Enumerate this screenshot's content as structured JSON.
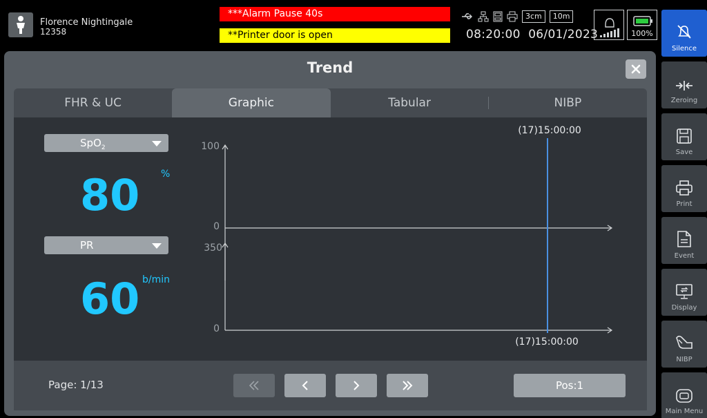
{
  "patient": {
    "name": "Florence Nightingale",
    "id": "12358"
  },
  "alarms": {
    "high": "***Alarm Pause 40s",
    "low": "**Printer door is open"
  },
  "status": {
    "speed": "3cm",
    "interval": "10m",
    "time": "08:20:00",
    "date": "06/01/2023",
    "battery": "100%"
  },
  "sidebar": [
    {
      "label": "Silence",
      "icon": "alarm-silence-icon"
    },
    {
      "label": "Zeroing",
      "icon": "zeroing-icon"
    },
    {
      "label": "Save",
      "icon": "save-icon"
    },
    {
      "label": "Print",
      "icon": "print-icon"
    },
    {
      "label": "Event",
      "icon": "event-icon"
    },
    {
      "label": "Display",
      "icon": "display-icon"
    },
    {
      "label": "NIBP",
      "icon": "nibp-cuff-icon"
    },
    {
      "label": "Main Menu",
      "icon": "main-menu-icon"
    }
  ],
  "dialog": {
    "title": "Trend",
    "tabs": [
      "FHR & UC",
      "Graphic",
      "Tabular",
      "NIBP"
    ],
    "active_tab": "Graphic"
  },
  "params": {
    "p1": {
      "name": "SpO",
      "sub": "2",
      "value": "80",
      "unit": "%"
    },
    "p2": {
      "name": "PR",
      "value": "60",
      "unit": "b/min"
    }
  },
  "chart_data": [
    {
      "type": "line",
      "title": "",
      "ylim": [
        0,
        100
      ],
      "y_ticks": [
        "100",
        "0"
      ],
      "cursor_label": "(17)15:00:00",
      "cursor_position": "right",
      "series": []
    },
    {
      "type": "line",
      "title": "",
      "ylim": [
        0,
        350
      ],
      "y_ticks": [
        "350",
        "0"
      ],
      "cursor_label": "(17)15:00:00",
      "cursor_position": "right",
      "series": []
    }
  ],
  "footer": {
    "page": "Page: 1/13",
    "pos": "Pos:1"
  },
  "colors": {
    "accent_value": "#21c8ff",
    "cursor": "#4a90e2",
    "alarm_high": "#ff0000",
    "alarm_low": "#ffff00",
    "silence": "#1f5fd0"
  }
}
